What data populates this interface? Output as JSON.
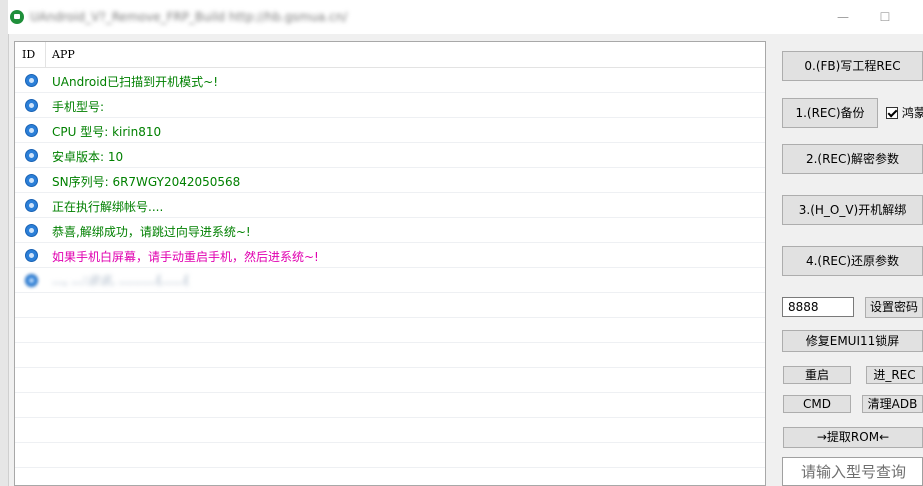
{
  "window": {
    "title": "UAndroid_V?_Remove_FRP_Build   http://hb.gsmua.cn/",
    "minimize_glyph": "—",
    "maximize_glyph": "☐"
  },
  "log": {
    "header": {
      "id": "ID",
      "app": "APP"
    },
    "rows": [
      {
        "text": "UAndroid已扫描到开机模式~!",
        "color": "#008000"
      },
      {
        "text": "手机型号:",
        "color": "#008000"
      },
      {
        "text": "CPU 型号: kirin810",
        "color": "#008000"
      },
      {
        "text": "安卓版本: 10",
        "color": "#008000"
      },
      {
        "text": "SN序列号: 6R7WGY2042050568",
        "color": "#008000"
      },
      {
        "text": "正在执行解绑帐号....",
        "color": "#008000"
      },
      {
        "text": "恭喜,解绑成功，请跳过向导进系统~!",
        "color": "#008000"
      },
      {
        "text": "如果手机白屏幕，请手动重启手机，然后进系统~!",
        "color": "#e000b0"
      },
      {
        "text": "..., ...:://://, ..........(......(",
        "color": "#7a8fa8"
      }
    ]
  },
  "buttons": {
    "fb_write": "0.(FB)写工程REC",
    "rec_backup": "1.(REC)备份",
    "rec_decrypt": "2.(REC)解密参数",
    "hov_unlock": "3.(H_O_V)开机解绑",
    "rec_restore": "4.(REC)还原参数",
    "set_password": "设置密码",
    "fix_emui": "修复EMUI11锁屏",
    "reboot": "重启",
    "enter_rec": "进_REC",
    "cmd": "CMD",
    "clean_adb": "清理ADB",
    "extract_rom": "→提取ROM←"
  },
  "checkbox": {
    "label": "鸿蒙",
    "checked": true
  },
  "password_field": {
    "value": "8888"
  },
  "model_search": {
    "placeholder": "请输入型号查询"
  }
}
